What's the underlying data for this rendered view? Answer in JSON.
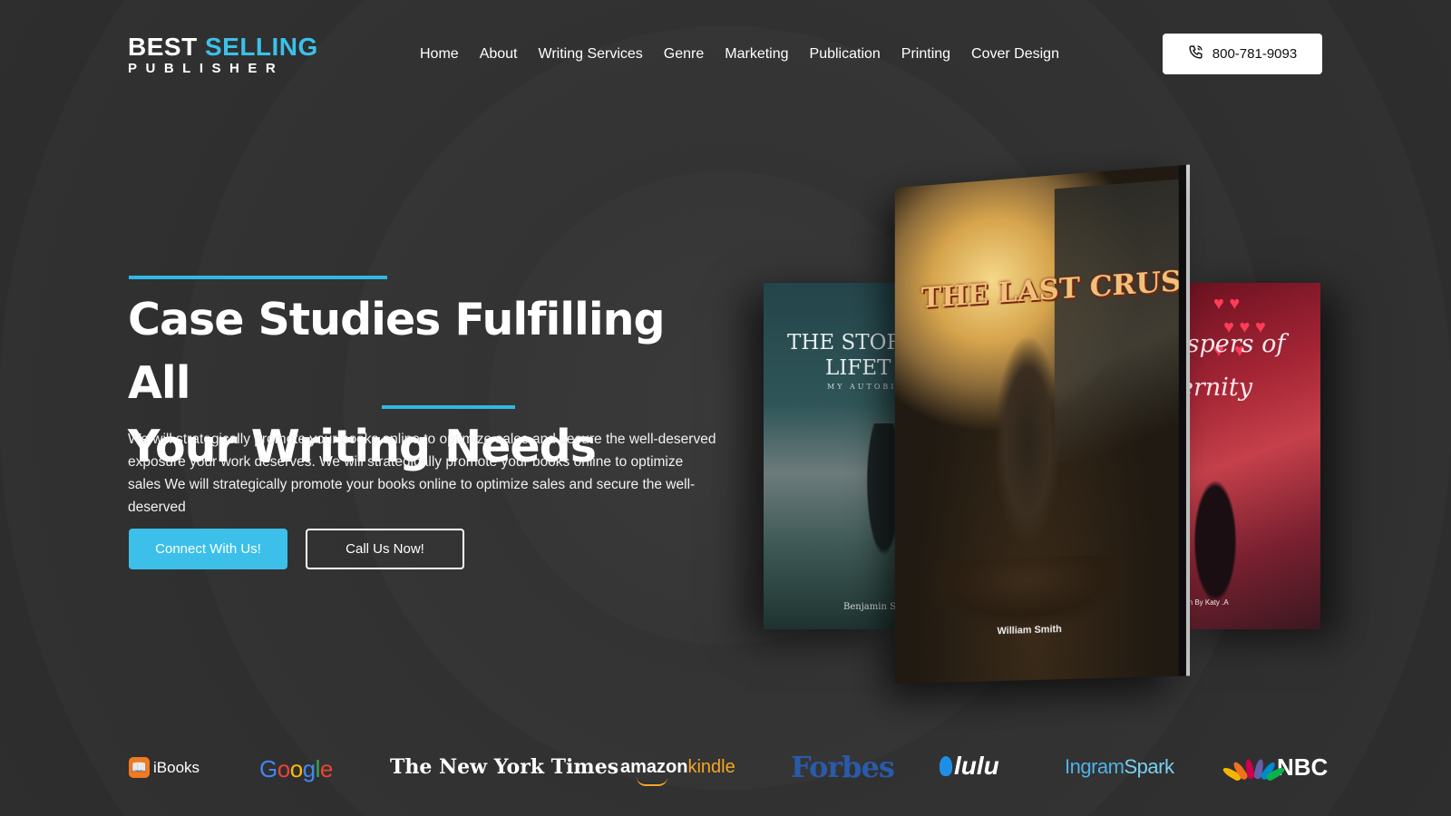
{
  "brand": {
    "line1_a": "BEST",
    "line1_b": "SELLING",
    "line2": "PUBLISHER",
    "accent_color": "#3cc0ea"
  },
  "nav": {
    "items": [
      "Home",
      "About",
      "Writing Services",
      "Genre",
      "Marketing",
      "Publication",
      "Printing",
      "Cover Design"
    ]
  },
  "header": {
    "phone": "800-781-9093",
    "phone_icon": "phone-icon"
  },
  "hero": {
    "title_line1": "Case Studies Fulfilling All",
    "title_line2": "Your Writing Needs",
    "description": "We will strategically promote your books online to optimize sales and secure the well-deserved exposure your work deserves. We will strategically promote your books online to optimize sales We will strategically promote your books online to optimize sales and secure the well-deserved",
    "primary_button": "Connect With Us!",
    "secondary_button": "Call Us Now!"
  },
  "books": {
    "left": {
      "title_line1": "THE STOR",
      "title_line2": "LIFET",
      "subtitle": "MY AUTOBIO",
      "author": "Benjamin S"
    },
    "main": {
      "title": "THE LAST CRUSADER",
      "author": "William Smith"
    },
    "right": {
      "title_line1": "ispers of",
      "title_line2": "ernity",
      "author": "ten By Katy .A"
    }
  },
  "partners": {
    "ibooks": "iBooks",
    "google": [
      "G",
      "o",
      "o",
      "g",
      "l",
      "e"
    ],
    "nyt": "The New York Times",
    "amazon_a": "amazon",
    "amazon_b": "kindle",
    "forbes": "Forbes",
    "lulu": "lulu",
    "ingram_a": "Ingram",
    "ingram_b": "Spark",
    "nbc": "NBC"
  }
}
